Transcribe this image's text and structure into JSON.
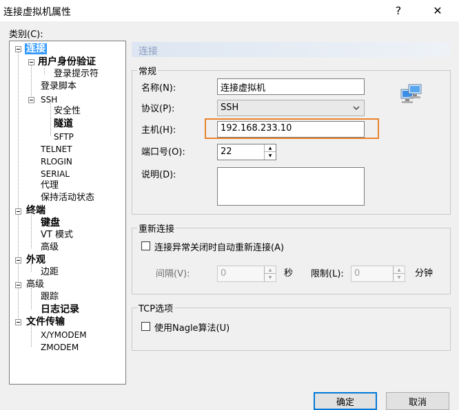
{
  "window": {
    "title": "连接虚拟机属性",
    "help_icon": "?",
    "close_icon": "✕"
  },
  "category_label": "类别(C):",
  "tree": {
    "connection": "连接",
    "user_auth": "用户身份验证",
    "login_prompts": "登录提示符",
    "login_script": "登录脚本",
    "ssh": "SSH",
    "security": "安全性",
    "tunneling": "隧道",
    "sftp": "SFTP",
    "telnet": "TELNET",
    "rlogin": "RLOGIN",
    "serial": "SERIAL",
    "proxy": "代理",
    "keep_alive": "保持活动状态",
    "terminal": "终端",
    "keyboard": "键盘",
    "vt_modes": "VT 模式",
    "advanced_term": "高级",
    "appearance": "外观",
    "margins": "边距",
    "advanced": "高级",
    "trace": "跟踪",
    "logging": "日志记录",
    "file_transfer": "文件传输",
    "xymodem": "X/YMODEM",
    "zmodem": "ZMODEM"
  },
  "header": "连接",
  "general": {
    "title": "常规",
    "name_label": "名称(N):",
    "name_value": "连接虚拟机",
    "protocol_label": "协议(P):",
    "protocol_value": "SSH",
    "host_label": "主机(H):",
    "host_value": "192.168.233.10",
    "port_label": "端口号(O):",
    "port_value": "22",
    "desc_label": "说明(D):",
    "desc_value": ""
  },
  "reconnect": {
    "title": "重新连接",
    "checkbox_label": "连接异常关闭时自动重新连接(A)",
    "interval_label": "间隔(V):",
    "interval_value": "0",
    "interval_unit": "秒",
    "limit_label": "限制(L):",
    "limit_value": "0",
    "limit_unit": "分钟"
  },
  "tcp": {
    "title": "TCP选项",
    "nagle_label": "使用Nagle算法(U)"
  },
  "buttons": {
    "ok": "确定",
    "cancel": "取消"
  },
  "colors": {
    "highlight": "#e8822a",
    "selection": "#3399ff",
    "default_button": "#0078d7"
  }
}
